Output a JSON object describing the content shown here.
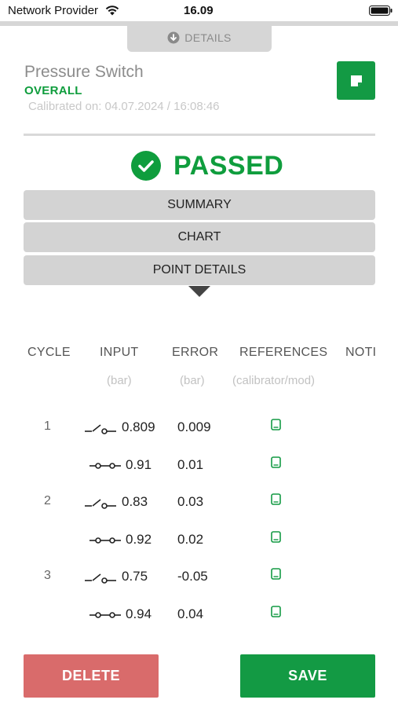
{
  "status_bar": {
    "carrier": "Network Provider",
    "time": "16.09"
  },
  "details_tab": {
    "label": "DETAILS",
    "icon": "chevron-down-circle-icon"
  },
  "header": {
    "title": "Pressure Switch",
    "subtitle": "OVERALL",
    "calibrated": "Calibrated on: 04.07.2024 / 16:08:46",
    "note_icon": "note-icon"
  },
  "result": {
    "label": "PASSED",
    "icon": "check-circle-icon",
    "color": "#0f9d3d"
  },
  "sections": {
    "summary": "SUMMARY",
    "chart": "CHART",
    "point_details": "POINT DETAILS"
  },
  "table": {
    "headers": {
      "cycle": "CYCLE",
      "input": "INPUT",
      "error": "ERROR",
      "references": "REFERENCES",
      "notes": "NOTI"
    },
    "units": {
      "input": "(bar)",
      "error": "(bar)",
      "references": "(calibrator/mod)"
    },
    "rows": [
      {
        "cycle": "1",
        "state": "open",
        "input": "0.809",
        "error": "0.009"
      },
      {
        "cycle": "",
        "state": "closed",
        "input": "0.91",
        "error": "0.01"
      },
      {
        "cycle": "2",
        "state": "open",
        "input": "0.83",
        "error": "0.03"
      },
      {
        "cycle": "",
        "state": "closed",
        "input": "0.92",
        "error": "0.02"
      },
      {
        "cycle": "3",
        "state": "open",
        "input": "0.75",
        "error": "-0.05"
      },
      {
        "cycle": "",
        "state": "closed",
        "input": "0.94",
        "error": "0.04"
      }
    ]
  },
  "actions": {
    "delete": "DELETE",
    "save": "SAVE"
  },
  "colors": {
    "green": "#139a44",
    "red": "#d96b6b",
    "gray": "#d3d3d3"
  }
}
